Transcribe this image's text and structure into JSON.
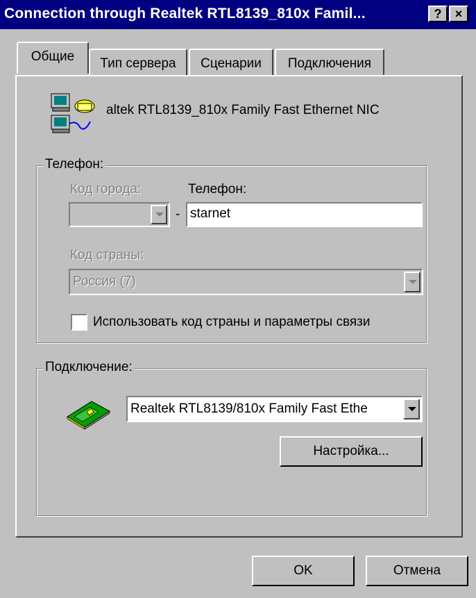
{
  "window": {
    "title": "Connection through Realtek RTL8139_810x Famil...",
    "help_button": "?",
    "close_button": "×"
  },
  "tabs": [
    {
      "label": "Общие"
    },
    {
      "label": "Тип сервера"
    },
    {
      "label": "Сценарии"
    },
    {
      "label": "Подключения"
    }
  ],
  "device": {
    "icon": "dialup-connection-icon",
    "name": "altek RTL8139_810x Family Fast Ethernet NIC"
  },
  "phone_group": {
    "legend": "Телефон:",
    "area_code_label": "Код города:",
    "area_code_value": "",
    "phone_label": "Телефон:",
    "phone_value": "starnet",
    "dash": "-",
    "country_label": "Код страны:",
    "country_value": "Россия (7)",
    "use_country_checkbox_label": "Использовать код страны и параметры связи",
    "use_country_checked": false
  },
  "connection_group": {
    "legend": "Подключение:",
    "icon": "network-card-icon",
    "device_value": "Realtek RTL8139/810x Family Fast Ethe",
    "settings_button": "Настройка..."
  },
  "footer": {
    "ok_button": "OK",
    "cancel_button": "Отмена"
  }
}
